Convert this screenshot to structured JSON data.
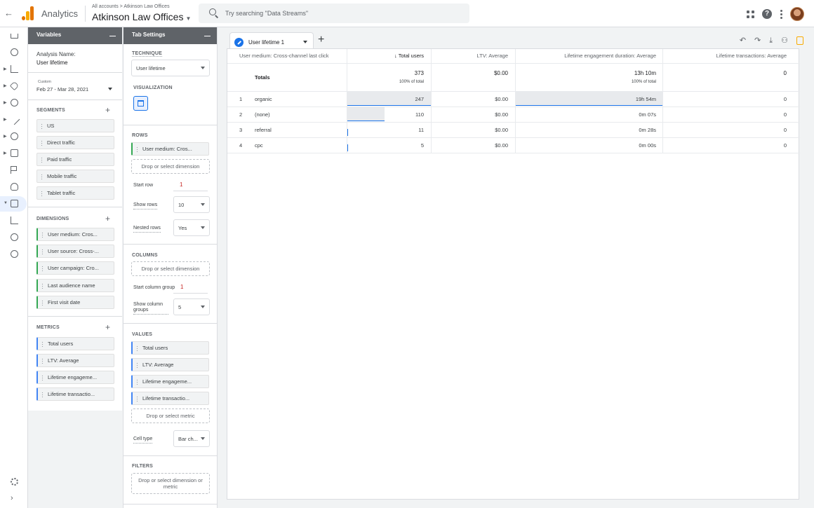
{
  "header": {
    "app_name": "Analytics",
    "breadcrumb": "All accounts > Atkinson Law Offices",
    "property": "Atkinson Law Offices",
    "search_placeholder": "Try searching \"Data Streams\""
  },
  "variables": {
    "title": "Variables",
    "analysis_name_label": "Analysis Name:",
    "analysis_name": "User lifetime",
    "date_label": "Custom",
    "date_range": "Feb 27 - Mar 28, 2021",
    "segments_label": "SEGMENTS",
    "segments": [
      "US",
      "Direct traffic",
      "Paid traffic",
      "Mobile traffic",
      "Tablet traffic"
    ],
    "dimensions_label": "DIMENSIONS",
    "dimensions": [
      "User medium: Cros...",
      "User source: Cross-...",
      "User campaign: Cro...",
      "Last audience name",
      "First visit date"
    ],
    "metrics_label": "METRICS",
    "metrics": [
      "Total users",
      "LTV: Average",
      "Lifetime engageme...",
      "Lifetime transactio..."
    ]
  },
  "tab_settings": {
    "title": "Tab Settings",
    "technique_label": "TECHNIQUE",
    "technique": "User lifetime",
    "visualization_label": "VISUALIZATION",
    "rows_label": "ROWS",
    "rows_dimension": "User medium: Cros...",
    "drop_dimension": "Drop or select dimension",
    "start_row_label": "Start row",
    "start_row": "1",
    "show_rows_label": "Show rows",
    "show_rows": "10",
    "nested_rows_label": "Nested rows",
    "nested_rows": "Yes",
    "columns_label": "COLUMNS",
    "start_col_group_label": "Start column group",
    "start_col_group": "1",
    "show_col_groups_label": "Show column groups",
    "show_col_groups": "5",
    "values_label": "VALUES",
    "values": [
      "Total users",
      "LTV: Average",
      "Lifetime engageme...",
      "Lifetime transactio..."
    ],
    "drop_metric": "Drop or select metric",
    "cell_type_label": "Cell type",
    "cell_type": "Bar ch...",
    "filters_label": "FILTERS",
    "drop_filter": "Drop or select dimension or metric"
  },
  "canvas": {
    "tab_label": "User lifetime 1",
    "columns": [
      "User medium: Cross-channel last click",
      "↓ Total users",
      "LTV: Average",
      "Lifetime engagement duration: Average",
      "Lifetime transactions: Average"
    ],
    "totals_label": "Totals",
    "totals": {
      "users": "373",
      "users_sub": "100% of total",
      "ltv": "$0.00",
      "engagement": "13h 10m",
      "engagement_sub": "100% of total",
      "transactions": "0"
    },
    "rows": [
      {
        "idx": "1",
        "medium": "organic",
        "users": "247",
        "users_frac": 1.0,
        "ltv": "$0.00",
        "engagement": "19h 54m",
        "engagement_frac": 1.0,
        "transactions": "0"
      },
      {
        "idx": "2",
        "medium": "(none)",
        "users": "110",
        "users_frac": 0.445,
        "ltv": "$0.00",
        "engagement": "0m 07s",
        "engagement_frac": 0.0,
        "transactions": "0"
      },
      {
        "idx": "3",
        "medium": "referral",
        "users": "11",
        "users_frac": 0.045,
        "ltv": "$0.00",
        "engagement": "0m 28s",
        "engagement_frac": 0.0,
        "transactions": "0"
      },
      {
        "idx": "4",
        "medium": "cpc",
        "users": "5",
        "users_frac": 0.02,
        "ltv": "$0.00",
        "engagement": "0m 00s",
        "engagement_frac": 0.0,
        "transactions": "0"
      }
    ]
  }
}
